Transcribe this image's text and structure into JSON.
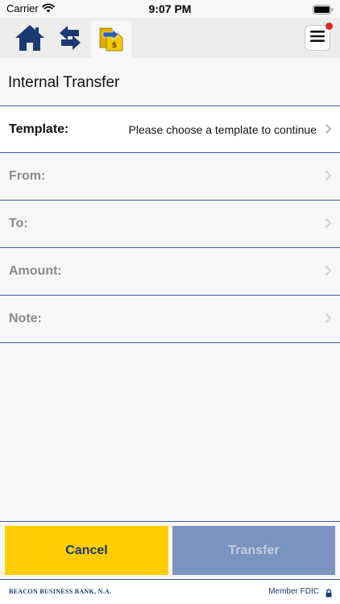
{
  "status_bar": {
    "carrier": "Carrier",
    "time": "9:07 PM"
  },
  "nav": {
    "icons": [
      "home-icon",
      "swap-arrows-icon",
      "transfer-icon",
      "menu-icon"
    ],
    "notification": true
  },
  "page": {
    "title": "Internal Transfer"
  },
  "form": {
    "rows": [
      {
        "label": "Template:",
        "value": "Please choose a template to continue"
      },
      {
        "label": "From:",
        "value": ""
      },
      {
        "label": "To:",
        "value": ""
      },
      {
        "label": "Amount:",
        "value": ""
      },
      {
        "label": "Note:",
        "value": ""
      }
    ]
  },
  "actions": {
    "cancel_label": "Cancel",
    "transfer_label": "Transfer"
  },
  "footer": {
    "bank_name": "BEACON BUSINESS BANK, N.A.",
    "fdic": "Member FDIC"
  },
  "colors": {
    "brand_navy": "#1b3a73",
    "accent_yellow": "#ffcd00",
    "disabled_blue": "#7b93bf",
    "divider": "#3c5a9a",
    "notification_red": "#e0242a"
  }
}
